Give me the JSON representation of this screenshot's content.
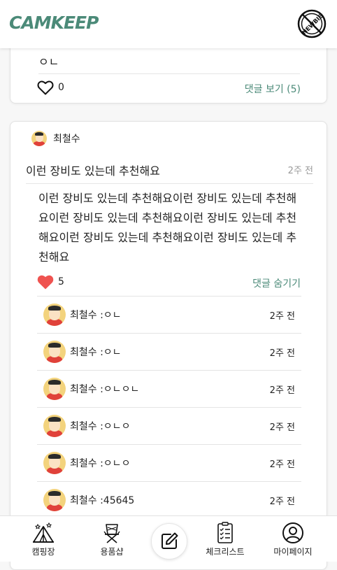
{
  "header": {
    "logo_text": "CAMKEEP",
    "badge_icon": "newbie-badge-icon",
    "badge_text": "NEWBIE"
  },
  "post_previous": {
    "content": "ㅇㄴ",
    "like_count": "0",
    "liked": false,
    "comment_toggle": "댓글 보기 (5)"
  },
  "post": {
    "author": "최철수",
    "title": "이런 장비도 있는데 추천해요",
    "time": "2주 전",
    "body": "이런 장비도 있는데 추천해요이런 장비도 있는데 추천해요이런 장비도 있는데 추천해요이런 장비도 있는데 추천해요이런 장비도 있는데 추천해요이런 장비도 있는데 추천해요",
    "like_count": "5",
    "liked": true,
    "comment_toggle": "댓글 숨기기",
    "comments": [
      {
        "text": "최철수 :ㅇㄴ",
        "time": "2주 전"
      },
      {
        "text": "최철수 :ㅇㄴ",
        "time": "2주 전"
      },
      {
        "text": "최철수 :ㅇㄴㅇㄴ",
        "time": "2주 전"
      },
      {
        "text": "최철수 :ㅇㄴㅇ",
        "time": "2주 전"
      },
      {
        "text": "최철수 :ㅇㄴㅇ",
        "time": "2주 전"
      },
      {
        "text": "최철수 :45645",
        "time": "2주 전"
      }
    ]
  },
  "bottom_nav": {
    "items": [
      {
        "label": "캠핑장",
        "icon": "tent-icon"
      },
      {
        "label": "용품샵",
        "icon": "camping-chair-icon"
      },
      {
        "label": "",
        "icon": "edit-icon"
      },
      {
        "label": "체크리스트",
        "icon": "checklist-icon"
      },
      {
        "label": "마이페이지",
        "icon": "user-icon"
      }
    ]
  },
  "colors": {
    "brand": "#4b8a78",
    "like_active": "#ef5350"
  }
}
